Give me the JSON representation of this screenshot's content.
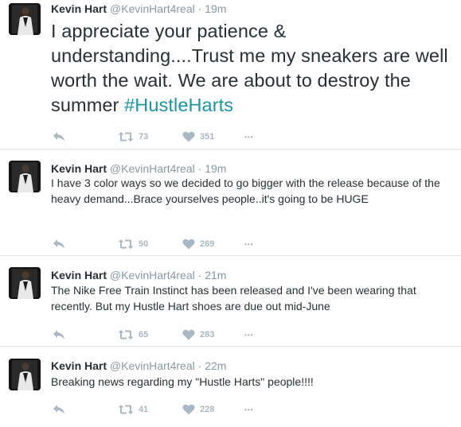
{
  "tweets": [
    {
      "name": "Kevin Hart",
      "handle": "@KevinHart4real",
      "dot": "·",
      "time": "19m",
      "text": "I appreciate your patience & understanding....Trust me my sneakers are well worth the wait. We are about to destroy the summer ",
      "hashtag": "#HustleHarts",
      "retweets": "73",
      "likes": "351",
      "more_label": "•••"
    },
    {
      "name": "Kevin Hart",
      "handle": "@KevinHart4real",
      "dot": "·",
      "time": "19m",
      "text": "I have 3 color ways so we decided to go bigger with the release because of the heavy demand...Brace yourselves people..it's going to be HUGE",
      "retweets": "50",
      "likes": "269",
      "more_label": "•••"
    },
    {
      "name": "Kevin Hart",
      "handle": "@KevinHart4real",
      "dot": "·",
      "time": "21m",
      "text": "The Nike Free Train Instinct has been released and I've been wearing that recently. But my Hustle Hart shoes are due out mid-June",
      "retweets": "65",
      "likes": "283",
      "more_label": "•••"
    },
    {
      "name": "Kevin Hart",
      "handle": "@KevinHart4real",
      "dot": "·",
      "time": "22m",
      "text": "Breaking news regarding my \"Hustle Harts\" people!!!!",
      "retweets": "41",
      "likes": "228",
      "more_label": "•••"
    }
  ],
  "colors": {
    "text": "#292f33",
    "meta": "#8899a6",
    "action": "#aab8c2",
    "hashtag": "#1b95a0",
    "divider": "#e1e8ed"
  },
  "icons": [
    "reply-icon",
    "retweet-icon",
    "heart-icon",
    "more-icon"
  ]
}
